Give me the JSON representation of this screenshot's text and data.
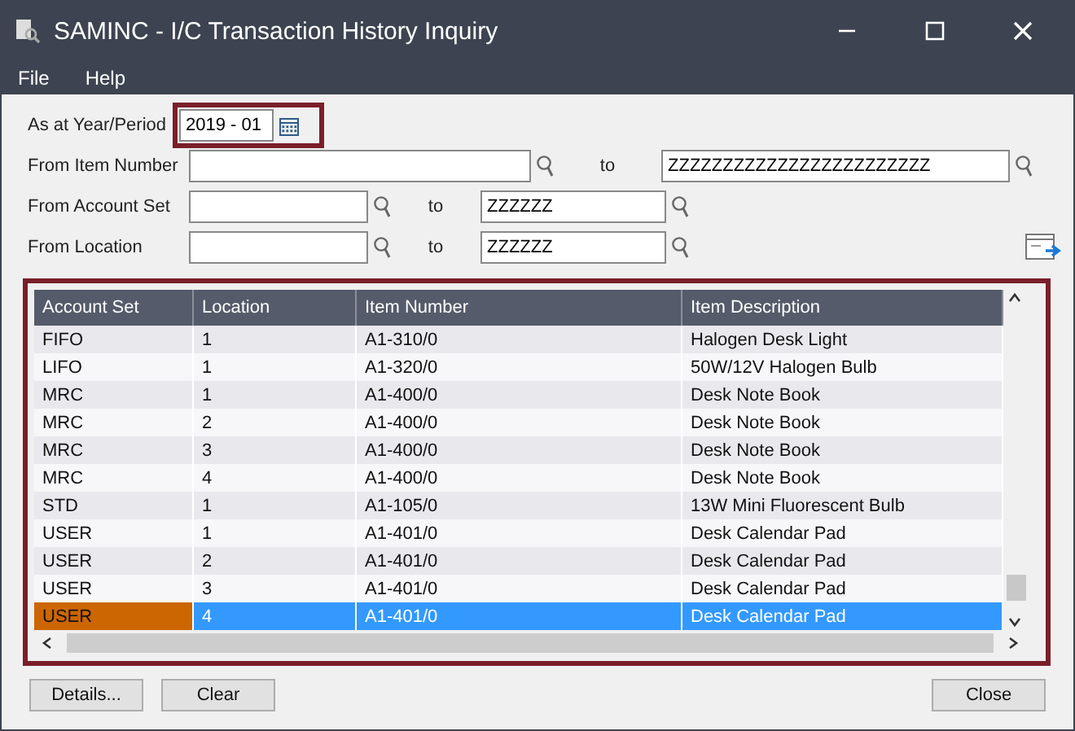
{
  "window": {
    "title": "SAMINC - I/C Transaction History Inquiry"
  },
  "menu": [
    "File",
    "Help"
  ],
  "filters": [
    {
      "kind": "period",
      "label": "As at Year/Period",
      "value": "2019 - 01"
    },
    {
      "kind": "range",
      "label": "From Item Number",
      "to_label": "to",
      "to": "ZZZZZZZZZZZZZZZZZZZZZZZZ",
      "wide": true
    },
    {
      "kind": "range",
      "label": "From Account Set",
      "to_label": "to",
      "to": "ZZZZZZ",
      "wide": false
    },
    {
      "kind": "range",
      "label": "From Location",
      "to_label": "to",
      "to": "ZZZZZZ",
      "wide": false
    }
  ],
  "table": {
    "columns": [
      "Account Set",
      "Location",
      "Item Number",
      "Item Description"
    ],
    "rows": [
      {
        "cells": [
          "FIFO",
          "1",
          "A1-310/0",
          "Halogen Desk Light"
        ],
        "selected": false
      },
      {
        "cells": [
          "LIFO",
          "1",
          "A1-320/0",
          "50W/12V Halogen Bulb"
        ],
        "selected": false
      },
      {
        "cells": [
          "MRC",
          "1",
          "A1-400/0",
          "Desk Note Book"
        ],
        "selected": false
      },
      {
        "cells": [
          "MRC",
          "2",
          "A1-400/0",
          "Desk Note Book"
        ],
        "selected": false
      },
      {
        "cells": [
          "MRC",
          "3",
          "A1-400/0",
          "Desk Note Book"
        ],
        "selected": false
      },
      {
        "cells": [
          "MRC",
          "4",
          "A1-400/0",
          "Desk Note Book"
        ],
        "selected": false
      },
      {
        "cells": [
          "STD",
          "1",
          "A1-105/0",
          "13W Mini Fluorescent Bulb"
        ],
        "selected": false
      },
      {
        "cells": [
          "USER",
          "1",
          "A1-401/0",
          "Desk Calendar Pad"
        ],
        "selected": false
      },
      {
        "cells": [
          "USER",
          "2",
          "A1-401/0",
          "Desk Calendar Pad"
        ],
        "selected": false
      },
      {
        "cells": [
          "USER",
          "3",
          "A1-401/0",
          "Desk Calendar Pad"
        ],
        "selected": false
      },
      {
        "cells": [
          "USER",
          "4",
          "A1-401/0",
          "Desk Calendar Pad"
        ],
        "selected": true
      }
    ]
  },
  "buttons_left": [
    "Details...",
    "Clear"
  ],
  "buttons_right": [
    "Close"
  ]
}
